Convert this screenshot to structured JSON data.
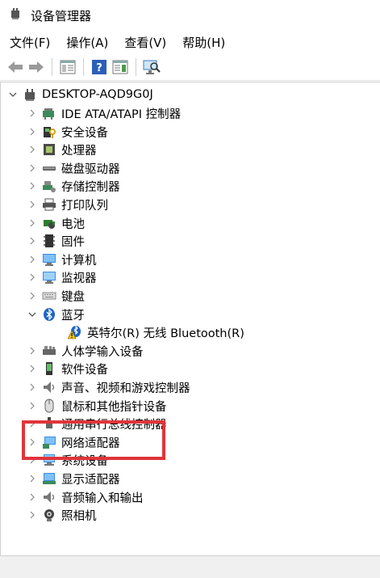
{
  "window": {
    "title": "设备管理器"
  },
  "menu": {
    "file": "文件(F)",
    "action": "操作(A)",
    "view": "查看(V)",
    "help": "帮助(H)"
  },
  "tree": {
    "root": "DESKTOP-AQD9G0J",
    "items": [
      {
        "label": "IDE ATA/ATAPI 控制器",
        "icon": "ide-controller-icon"
      },
      {
        "label": "安全设备",
        "icon": "security-device-icon"
      },
      {
        "label": "处理器",
        "icon": "processor-icon"
      },
      {
        "label": "磁盘驱动器",
        "icon": "disk-drive-icon"
      },
      {
        "label": "存储控制器",
        "icon": "storage-controller-icon"
      },
      {
        "label": "打印队列",
        "icon": "printer-icon"
      },
      {
        "label": "电池",
        "icon": "battery-icon"
      },
      {
        "label": "固件",
        "icon": "firmware-icon"
      },
      {
        "label": "计算机",
        "icon": "computer-icon"
      },
      {
        "label": "监视器",
        "icon": "monitor-icon"
      },
      {
        "label": "键盘",
        "icon": "keyboard-icon"
      },
      {
        "label": "蓝牙",
        "icon": "bluetooth-icon",
        "expanded": true
      },
      {
        "label": "英特尔(R) 无线 Bluetooth(R)",
        "icon": "warning-bluetooth-icon",
        "child": true
      },
      {
        "label": "人体学输入设备",
        "icon": "hid-icon"
      },
      {
        "label": "软件设备",
        "icon": "software-device-icon"
      },
      {
        "label": "声音、视频和游戏控制器",
        "icon": "sound-icon"
      },
      {
        "label": "鼠标和其他指针设备",
        "icon": "mouse-icon"
      },
      {
        "label": "通用串行总线控制器",
        "icon": "usb-icon"
      },
      {
        "label": "网络适配器",
        "icon": "network-adapter-icon"
      },
      {
        "label": "系统设备",
        "icon": "system-device-icon"
      },
      {
        "label": "显示适配器",
        "icon": "display-adapter-icon"
      },
      {
        "label": "音频输入和输出",
        "icon": "audio-io-icon"
      },
      {
        "label": "照相机",
        "icon": "camera-icon"
      }
    ]
  }
}
